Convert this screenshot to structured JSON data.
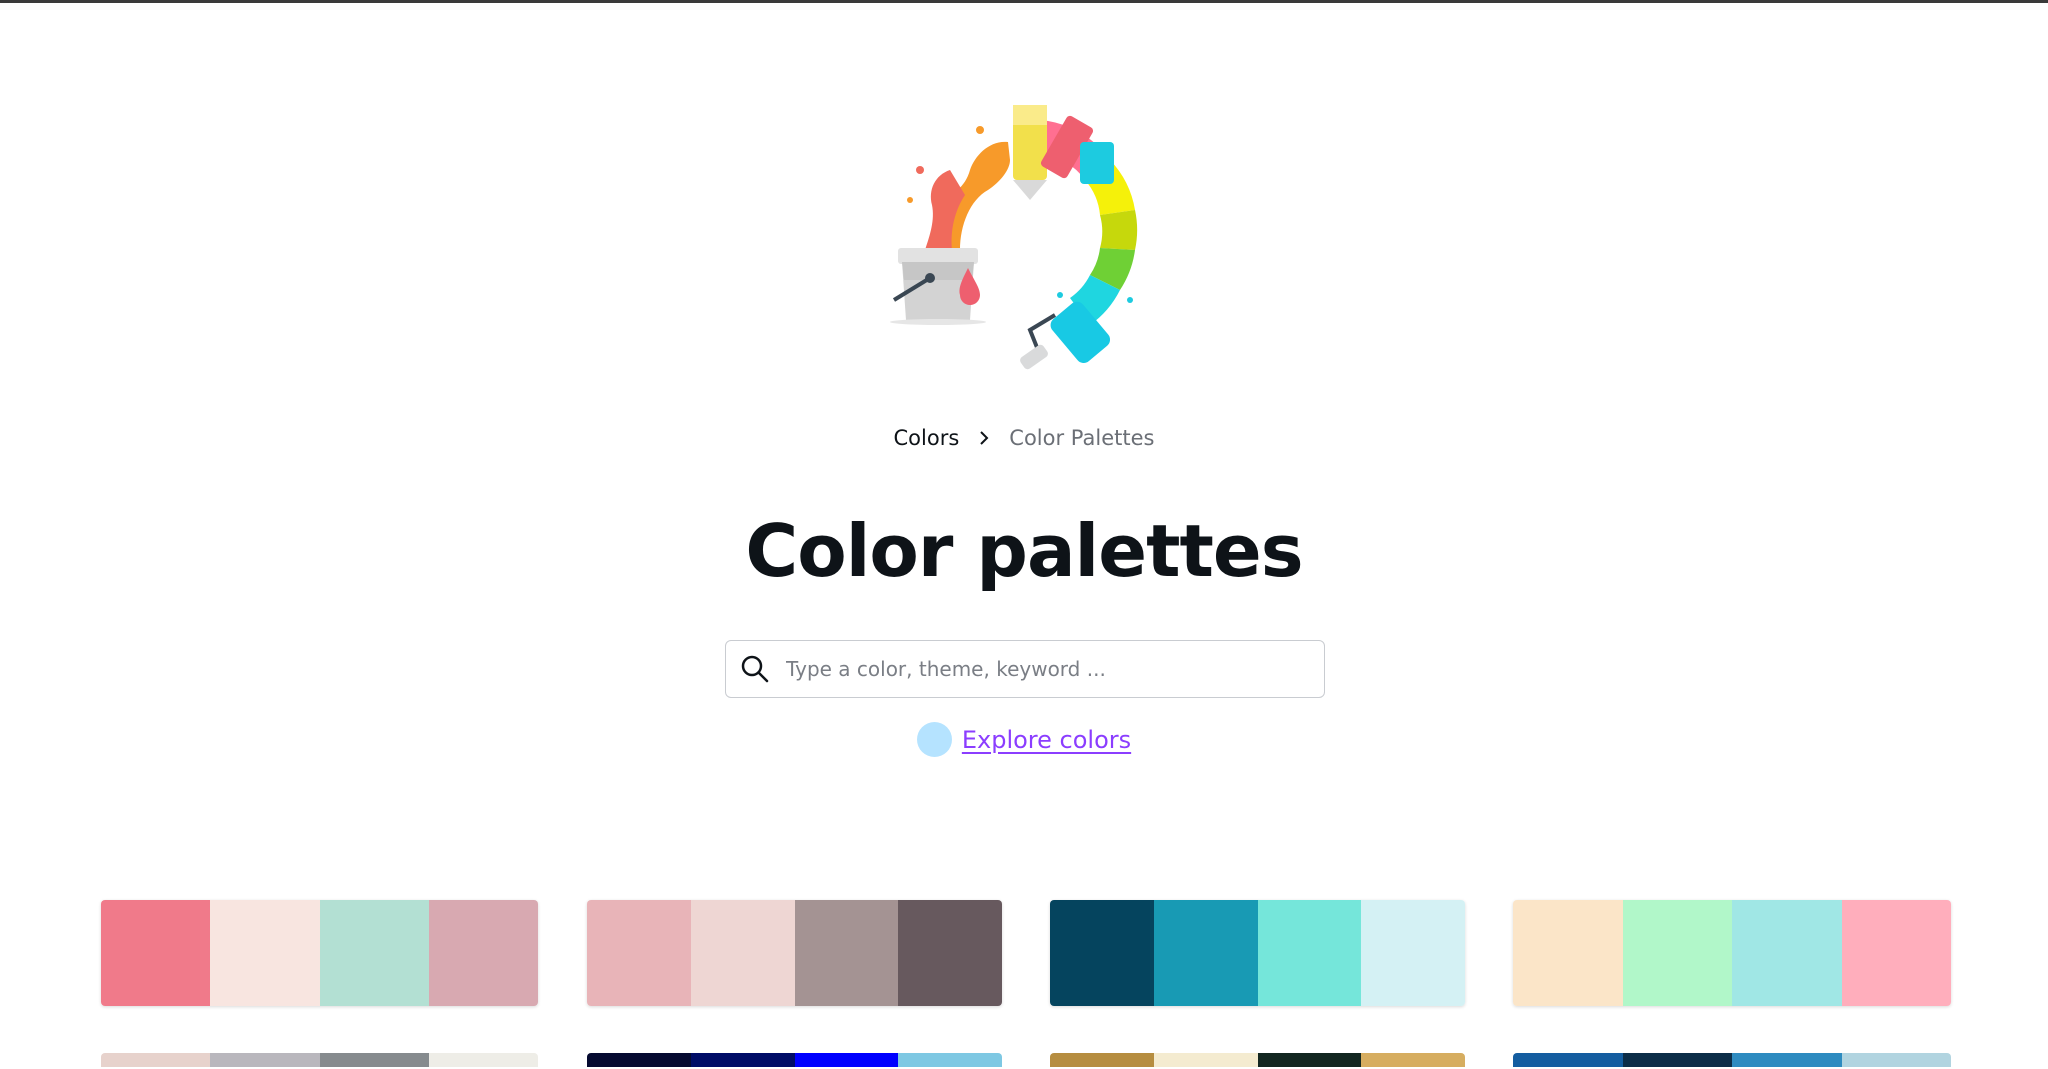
{
  "breadcrumb": {
    "root": "Colors",
    "current": "Color Palettes"
  },
  "page": {
    "title": "Color palettes"
  },
  "search": {
    "placeholder": "Type a color, theme, keyword ..."
  },
  "explore": {
    "label": "Explore colors",
    "dot_color": "#b5e3ff"
  },
  "accent": "#8b3dff",
  "palettes": [
    {
      "colors": [
        "#f07a8a",
        "#f8e5e0",
        "#b3e0d3",
        "#d8a9b1"
      ]
    },
    {
      "colors": [
        "#e8b4b8",
        "#eed6d3",
        "#a49393",
        "#67595e"
      ]
    },
    {
      "colors": [
        "#05445e",
        "#189ab4",
        "#75e6da",
        "#d4f1f4"
      ]
    },
    {
      "colors": [
        "#fbe5c8",
        "#b1f7c9",
        "#a0e7e5",
        "#ffaebc"
      ]
    },
    {
      "colors": [
        "#e7d2cc",
        "#b9b7bd",
        "#868b8e",
        "#eeede7"
      ]
    },
    {
      "colors": [
        "#050a30",
        "#000c66",
        "#0000ff",
        "#7ec8e3"
      ]
    },
    {
      "colors": [
        "#b68d40",
        "#f4ebd0",
        "#122620",
        "#d6ad60"
      ]
    },
    {
      "colors": [
        "#145da0",
        "#0c2d48",
        "#2e8bc0",
        "#b1d4e0"
      ]
    }
  ],
  "icons": [
    "paint-splash-illustration",
    "chevron-right-icon",
    "search-icon"
  ]
}
